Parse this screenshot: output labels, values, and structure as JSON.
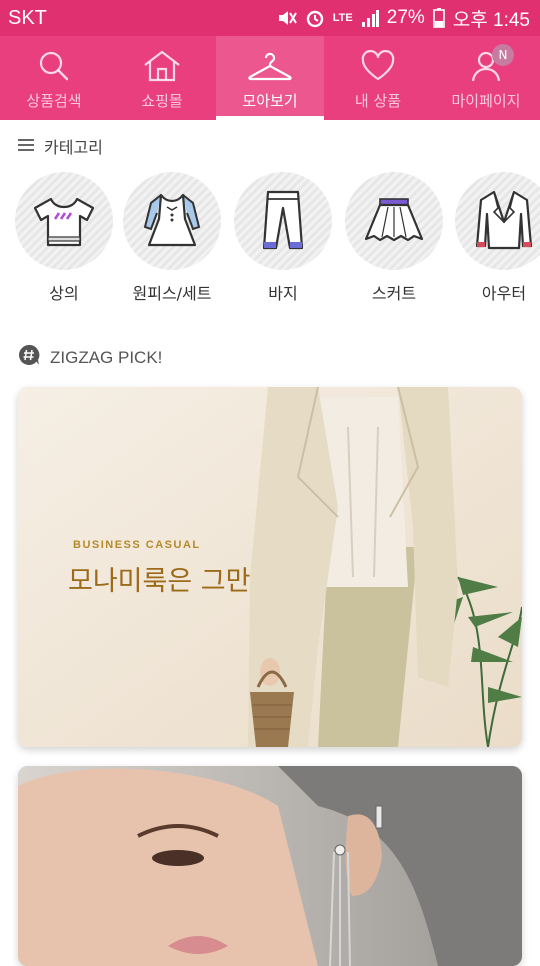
{
  "status_bar": {
    "carrier": "SKT",
    "network": "LTE",
    "battery": "27%",
    "time": "오후 1:45"
  },
  "nav": {
    "tabs": [
      {
        "label": "상품검색",
        "icon": "search-icon"
      },
      {
        "label": "쇼핑몰",
        "icon": "house-icon"
      },
      {
        "label": "모아보기",
        "icon": "hanger-icon",
        "active": true
      },
      {
        "label": "내 상품",
        "icon": "heart-icon"
      },
      {
        "label": "마이페이지",
        "icon": "person-icon",
        "badge": "N"
      }
    ]
  },
  "category": {
    "title": "카테고리",
    "items": [
      {
        "label": "상의",
        "icon": "tshirt-icon"
      },
      {
        "label": "원피스/세트",
        "icon": "dress-icon"
      },
      {
        "label": "바지",
        "icon": "pants-icon"
      },
      {
        "label": "스커트",
        "icon": "skirt-icon"
      },
      {
        "label": "아우터",
        "icon": "jacket-icon"
      }
    ]
  },
  "pick": {
    "title": "ZIGZAG PICK!",
    "banners": [
      {
        "eyebrow": "BUSINESS CASUAL",
        "title": "모나미룩은 그만"
      },
      {
        "eyebrow": "",
        "title": ""
      }
    ]
  },
  "colors": {
    "status_bar": "#e0306f",
    "nav_bar": "#ea3f7f",
    "banner_text": "#9c6b1a"
  }
}
